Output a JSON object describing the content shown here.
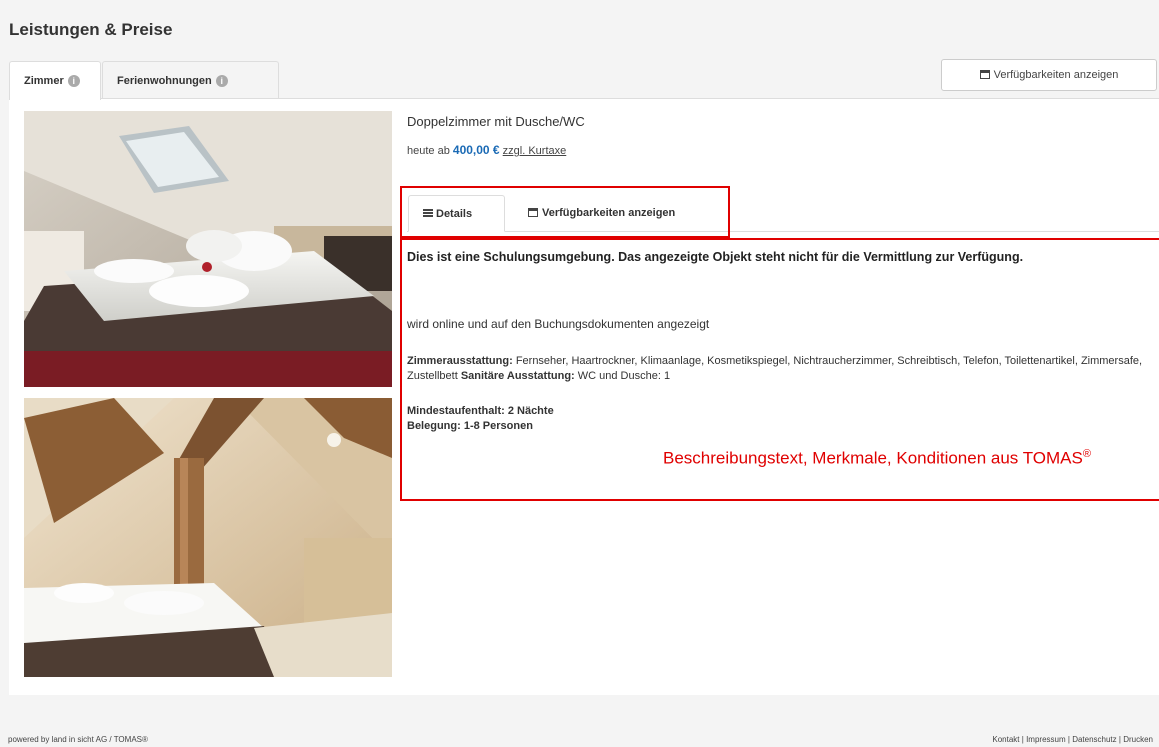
{
  "header": {
    "title": "Leistungen & Preise"
  },
  "tabs": [
    {
      "label": "Zimmer"
    },
    {
      "label": "Ferienwohnungen"
    }
  ],
  "availability_button": {
    "label": "Verfügbarkeiten anzeigen"
  },
  "room": {
    "title": "Doppelzimmer mit Dusche/WC",
    "price_prefix": "heute ab",
    "price": "400,00 €",
    "price_suffix": "zzgl. Kurtaxe"
  },
  "inner_tabs": [
    {
      "label": "Details"
    },
    {
      "label": "Verfügbarkeiten anzeigen"
    }
  ],
  "details": {
    "notice": "Dies ist eine Schulungsumgebung. Das angezeigte Objekt steht nicht für die Vermittlung zur Verfügung.",
    "online_text": "wird online und auf den Buchungsdokumenten angezeigt",
    "equipment_label": "Zimmerausstattung:",
    "equipment_value": "Fernseher, Haartrockner, Klimaanlage, Kosmetikspiegel, Nichtraucherzimmer, Schreibtisch, Telefon, Toilettenartikel, Zimmersafe, Zustellbett",
    "sanitary_label": "Sanitäre Ausstattung:",
    "sanitary_value": "WC und Dusche: 1",
    "min_stay": "Mindestaufenthalt: 2 Nächte",
    "occupancy": "Belegung: 1-8 Personen"
  },
  "annotation": {
    "text": "Beschreibungstext, Merkmale, Konditionen aus TOMAS",
    "mark": "®",
    "color": "#e00000"
  },
  "footer": {
    "left": "powered by land in sicht AG / TOMAS®",
    "links": [
      "Kontakt",
      "Impressum",
      "Datenschutz",
      "Drucken"
    ],
    "separator": "|"
  },
  "colors": {
    "accent": "#1a6ab5",
    "annotation_red": "#e00000"
  },
  "icons": {
    "info": "info-icon",
    "calendar": "calendar-icon",
    "list": "list-icon"
  }
}
